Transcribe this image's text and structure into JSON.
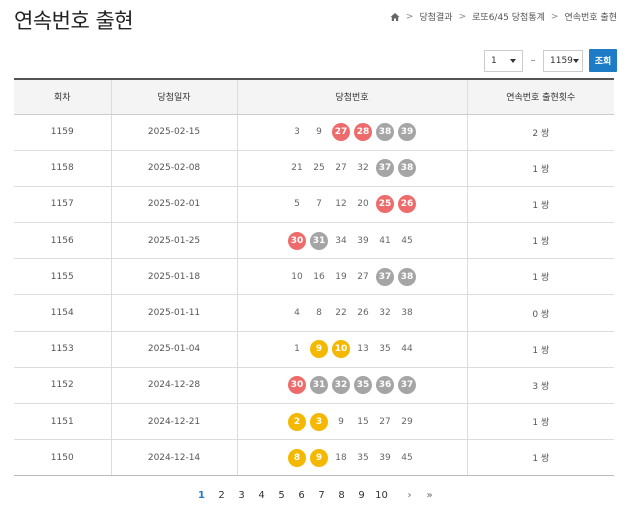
{
  "title": "연속번호 출현",
  "breadcrumb": [
    "당첨결과",
    "로또6/45 당첨통계",
    "연속번호 출현"
  ],
  "range": {
    "from": "1",
    "to": "1159",
    "button": "조회"
  },
  "table": {
    "headers": [
      "회차",
      "당첨일자",
      "당첨번호",
      "연속번호 출현횟수"
    ],
    "rows": [
      {
        "round": "1159",
        "date": "2025-02-15",
        "numbers": [
          "3",
          "9",
          "27",
          "28",
          "38",
          "39"
        ],
        "count": "2 쌍"
      },
      {
        "round": "1158",
        "date": "2025-02-08",
        "numbers": [
          "21",
          "25",
          "27",
          "32",
          "37",
          "38"
        ],
        "count": "1 쌍"
      },
      {
        "round": "1157",
        "date": "2025-02-01",
        "numbers": [
          "5",
          "7",
          "12",
          "20",
          "25",
          "26"
        ],
        "count": "1 쌍"
      },
      {
        "round": "1156",
        "date": "2025-01-25",
        "numbers": [
          "30",
          "31",
          "34",
          "39",
          "41",
          "45"
        ],
        "count": "1 쌍"
      },
      {
        "round": "1155",
        "date": "2025-01-18",
        "numbers": [
          "10",
          "16",
          "19",
          "27",
          "37",
          "38"
        ],
        "count": "1 쌍"
      },
      {
        "round": "1154",
        "date": "2025-01-11",
        "numbers": [
          "4",
          "8",
          "22",
          "26",
          "32",
          "38"
        ],
        "count": "0 쌍"
      },
      {
        "round": "1153",
        "date": "2025-01-04",
        "numbers": [
          "1",
          "9",
          "10",
          "13",
          "35",
          "44"
        ],
        "count": "1 쌍"
      },
      {
        "round": "1152",
        "date": "2024-12-28",
        "numbers": [
          "30",
          "31",
          "32",
          "35",
          "36",
          "37"
        ],
        "count": "3 쌍"
      },
      {
        "round": "1151",
        "date": "2024-12-21",
        "numbers": [
          "2",
          "3",
          "9",
          "15",
          "27",
          "29"
        ],
        "count": "1 쌍"
      },
      {
        "round": "1150",
        "date": "2024-12-14",
        "numbers": [
          "8",
          "9",
          "18",
          "35",
          "39",
          "45"
        ],
        "count": "1 쌍"
      }
    ]
  },
  "highlights": [
    [
      2,
      3,
      4,
      5
    ],
    [
      4,
      5
    ],
    [
      4,
      5
    ],
    [
      0,
      1
    ],
    [
      4,
      5
    ],
    [],
    [
      1,
      2
    ],
    [
      0,
      1,
      2,
      3,
      4,
      5
    ],
    [
      0,
      1
    ],
    [
      0,
      1
    ]
  ],
  "colors": {
    "yellow": "#f5b800",
    "red": "#ee6b6b",
    "gray": "#a5a5a5",
    "accent": "#1e7bc6"
  },
  "pagination": {
    "pages": [
      "1",
      "2",
      "3",
      "4",
      "5",
      "6",
      "7",
      "8",
      "9",
      "10"
    ],
    "current": "1",
    "next": "›",
    "last": "»"
  },
  "icons": {
    "home": "home-icon",
    "separator": "chevron-right-icon",
    "dropdown": "caret-down-icon"
  }
}
